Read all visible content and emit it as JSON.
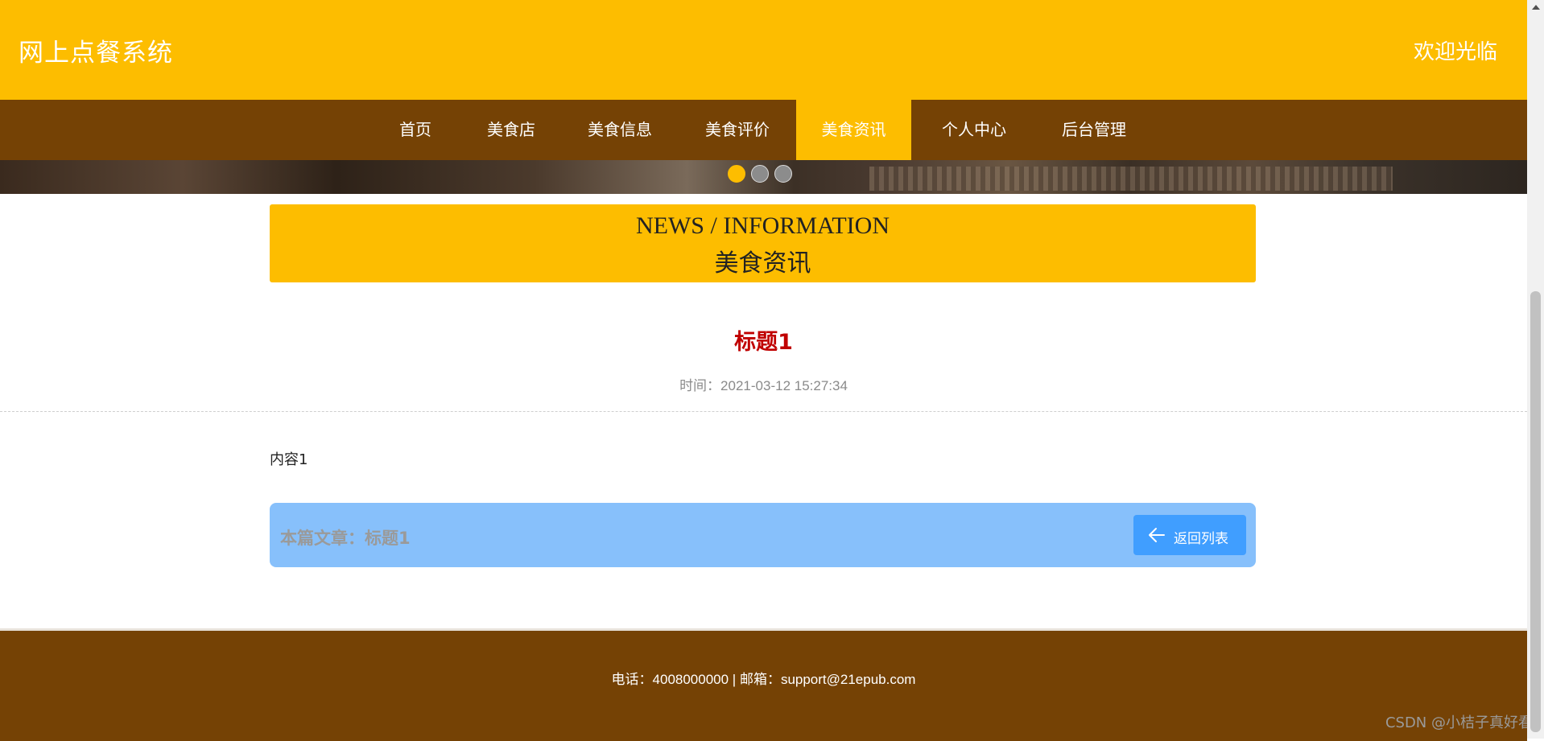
{
  "header": {
    "site_title": "网上点餐系统",
    "welcome": "欢迎光临"
  },
  "nav": {
    "items": [
      {
        "label": "首页"
      },
      {
        "label": "美食店"
      },
      {
        "label": "美食信息"
      },
      {
        "label": "美食评价"
      },
      {
        "label": "美食资讯",
        "active": true
      },
      {
        "label": "个人中心"
      },
      {
        "label": "后台管理"
      }
    ]
  },
  "carousel": {
    "slides": 3,
    "active_index": 0
  },
  "section": {
    "title_en": "NEWS / INFORMATION",
    "title_cn": "美食资讯"
  },
  "article": {
    "title": "标题1",
    "time": "时间：2021-03-12 15:27:34",
    "content": "内容1",
    "current_label": "本篇文章：标题1",
    "back_button": "返回列表",
    "back_icon": "arrow-left-icon"
  },
  "footer": {
    "contact": "电话：4008000000 | 邮箱：support@21epub.com"
  },
  "watermark": "CSDN @小桔子真好看",
  "colors": {
    "header_bg": "#fdbd00",
    "nav_bg": "#754205",
    "active_nav_bg": "#fdbd00",
    "title_red": "#c00000",
    "info_bar_bg": "#87c0fb",
    "button_blue": "#409eff"
  }
}
